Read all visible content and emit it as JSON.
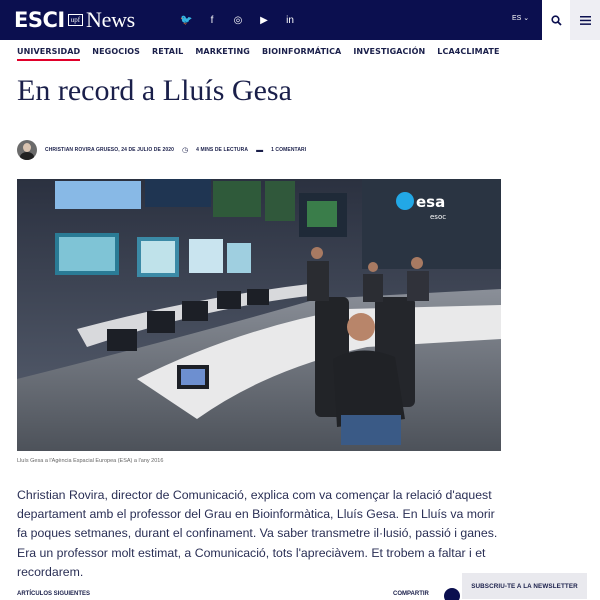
{
  "brand": {
    "esci": "ESCI",
    "upf": "upf",
    "news": "News"
  },
  "header": {
    "social_icons": [
      "twitter-icon",
      "facebook-icon",
      "instagram-icon",
      "youtube-icon",
      "linkedin-icon"
    ],
    "social_glyphs": [
      "🐦",
      "f",
      "◎",
      "▶",
      "in"
    ],
    "lang": "ES ⌄",
    "colors": {
      "header_bg": "#0b0f4f",
      "accent": "#e0002a"
    }
  },
  "nav": {
    "items": [
      "UNIVERSIDAD",
      "NEGOCIOS",
      "RETAIL",
      "MARKETING",
      "BIOINFORMÁTICA",
      "INVESTIGACIÓN",
      "LCA4CLIMATE"
    ]
  },
  "article": {
    "title": "En record a Lluís Gesa",
    "author_date": "CHRISTIAN ROVIRA GRUESO, 24 DE JULIO DE 2020",
    "read_time": "4 MINS DE LECTURA",
    "comments": "1 COMENTARI",
    "caption": "Lluís Gesa a l'Agència Espacial Europea (ESA) a l'any 2016",
    "body": "Christian Rovira, director de Comunicació, explica com va començar la relació d'aquest departament amb el professor del Grau en Bioinformàtica, Lluís Gesa. En Lluís va morir fa poques setmanes, durant el confinament. Va saber transmetre il·lusió, passió i ganes. Era un professor molt estimat, a Comunicació, tots l'aprecià­vem. Et trobem a faltar i et recordarem."
  },
  "photo": {
    "logo_text": "esa",
    "sub_text": "esoc"
  },
  "footer": {
    "left_label": "ARTÍCULOS SIGUIENTES",
    "right_label": "COMPARTIR",
    "newsletter": "SUBSCRIU-TE A LA NEWSLETTER"
  }
}
